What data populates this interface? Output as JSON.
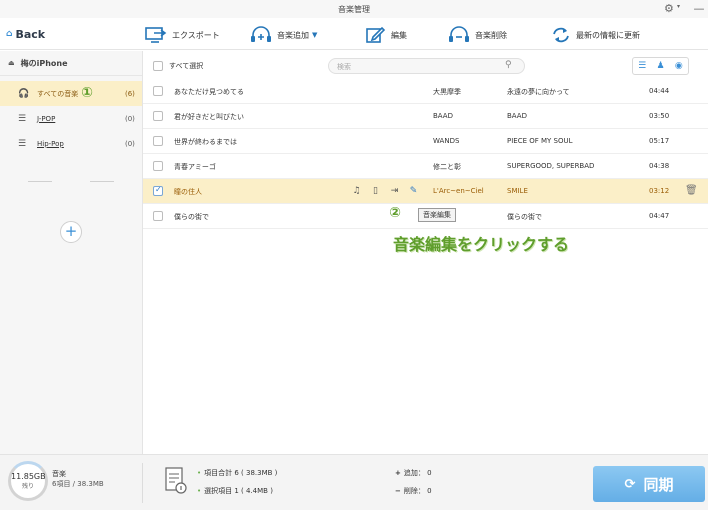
{
  "window": {
    "title": "音楽管理"
  },
  "toolbar": {
    "back_label": "Back",
    "export_label": "エクスポート",
    "add_label": "音楽追加",
    "edit_label": "編集",
    "delete_label": "音楽削除",
    "update_label": "最新の情報に更新"
  },
  "sidebar": {
    "device_name": "梅のiPhone",
    "items": [
      {
        "label": "すべての音楽",
        "count": "(6)",
        "selected": true
      },
      {
        "label": "J-POP",
        "count": "(0)",
        "selected": false
      },
      {
        "label": "Hip-Pop",
        "count": "(0)",
        "selected": false
      }
    ]
  },
  "list": {
    "select_all_label": "すべて選択",
    "search_placeholder": "検索",
    "rows": [
      {
        "title": "あなただけ見つめてる",
        "artist": "大黒摩季",
        "album": "永遠の夢に向かって",
        "duration": "04:44",
        "selected": false
      },
      {
        "title": "君が好きだと叫びたい",
        "artist": "BAAD",
        "album": "BAAD",
        "duration": "03:50",
        "selected": false
      },
      {
        "title": "世界が終わるまでは",
        "artist": "WANDS",
        "album": "PIECE OF MY SOUL",
        "duration": "05:17",
        "selected": false
      },
      {
        "title": "青春アミーゴ",
        "artist": "修二と彰",
        "album": "SUPERGOOD, SUPERBAD",
        "duration": "04:38",
        "selected": false
      },
      {
        "title": "瞳の住人",
        "artist": "L'Arc~en~Ciel",
        "album": "SMILE",
        "duration": "03:12",
        "selected": true
      },
      {
        "title": "僕らの街で",
        "artist": "",
        "album": "僕らの街で",
        "duration": "04:47",
        "selected": false
      }
    ]
  },
  "annotations": {
    "marker_1": "①",
    "marker_2": "②",
    "tooltip": "音楽編集",
    "caption": "音楽編集をクリックする"
  },
  "footer": {
    "storage_size": "11.85GB",
    "storage_remaining": "残り",
    "category": "音楽",
    "category_info": "6項目 / 38.3MB",
    "total_label": "項目合計 6 ( 38.3MB )",
    "selected_label": "選択項目 1 ( 4.4MB )",
    "add_label": "追加： 0",
    "delete_label": "削除： 0",
    "sync_label": "同期"
  },
  "colors": {
    "accent": "#3a8fd6",
    "selected_bg": "#fbefc8",
    "annotation_green": "#5f9e2c",
    "sync_button": "#74bbec"
  }
}
